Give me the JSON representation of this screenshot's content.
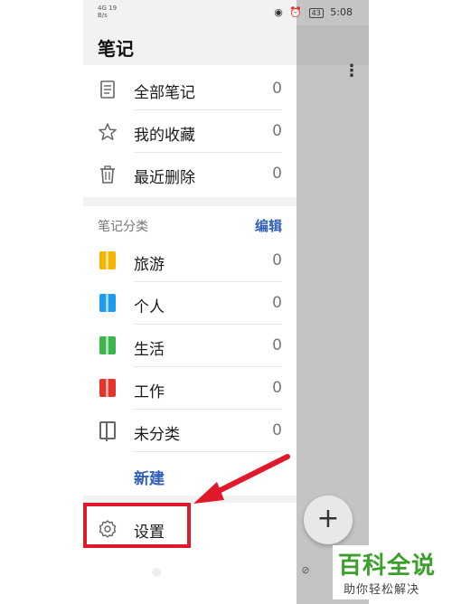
{
  "status_bar": {
    "signal_text": "4G",
    "speed_value": "19",
    "speed_unit": "B/s",
    "battery": "43",
    "time": "5:08"
  },
  "drawer": {
    "title": "笔记",
    "main_items": [
      {
        "label": "全部笔记",
        "count": "0",
        "icon": "document-icon"
      },
      {
        "label": "我的收藏",
        "count": "0",
        "icon": "star-icon"
      },
      {
        "label": "最近删除",
        "count": "0",
        "icon": "trash-icon"
      }
    ],
    "categories": {
      "header": "笔记分类",
      "edit_label": "编辑",
      "items": [
        {
          "label": "旅游",
          "count": "0",
          "color": "#f5b400"
        },
        {
          "label": "个人",
          "count": "0",
          "color": "#1d9bf0"
        },
        {
          "label": "生活",
          "count": "0",
          "color": "#3cb54a"
        },
        {
          "label": "工作",
          "count": "0",
          "color": "#e8332a"
        },
        {
          "label": "未分类",
          "count": "0",
          "color": "#666666"
        }
      ],
      "new_label": "新建"
    },
    "settings_label": "设置"
  },
  "background_app": {
    "more_icon": "more-vertical-icon",
    "fab_label": "+"
  },
  "annotation": {
    "highlight_color": "#e0192a"
  },
  "watermark": {
    "main": "百科全说",
    "sub": "助你轻松解决"
  }
}
